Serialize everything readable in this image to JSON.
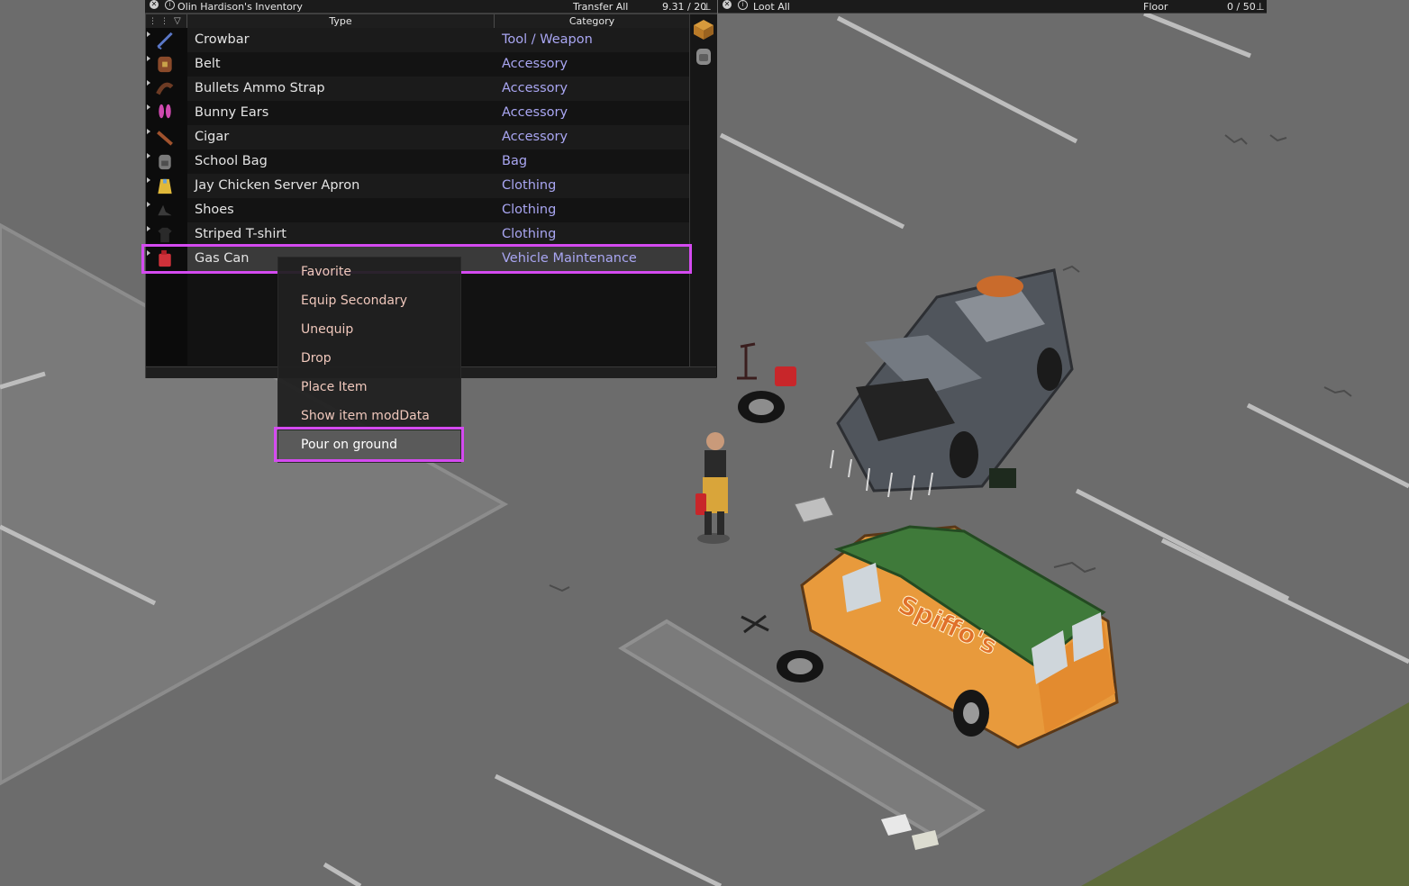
{
  "inventory": {
    "title": "Olin Hardison's Inventory",
    "transfer_all": "Transfer All",
    "weight": "9.31 / 20",
    "columns": {
      "type": "Type",
      "category": "Category"
    },
    "items": [
      {
        "type": "Crowbar",
        "category": "Tool / Weapon",
        "icon": "crowbar-icon"
      },
      {
        "type": "Belt",
        "category": "Accessory",
        "icon": "belt-icon"
      },
      {
        "type": "Bullets Ammo Strap",
        "category": "Accessory",
        "icon": "ammo-strap-icon"
      },
      {
        "type": "Bunny Ears",
        "category": "Accessory",
        "icon": "bunny-ears-icon"
      },
      {
        "type": "Cigar",
        "category": "Accessory",
        "icon": "cigar-icon"
      },
      {
        "type": "School Bag",
        "category": "Bag",
        "icon": "school-bag-icon"
      },
      {
        "type": "Jay Chicken Server Apron",
        "category": "Clothing",
        "icon": "apron-icon"
      },
      {
        "type": "Shoes",
        "category": "Clothing",
        "icon": "shoes-icon"
      },
      {
        "type": "Striped T-shirt",
        "category": "Clothing",
        "icon": "tshirt-icon"
      },
      {
        "type": "Gas Can",
        "category": "Vehicle Maintenance",
        "icon": "gas-can-icon"
      }
    ],
    "selected_index": 9
  },
  "loot": {
    "loot_all": "Loot All",
    "location": "Floor",
    "weight": "0 / 50"
  },
  "context_menu": {
    "items": [
      "Favorite",
      "Equip Secondary",
      "Unequip",
      "Drop",
      "Place Item",
      "Show item modData",
      "Pour on ground"
    ],
    "active_index": 6
  },
  "world": {
    "van_sign": "Spiffo's"
  },
  "colors": {
    "category_text": "#a9a6f2",
    "menu_text": "#f0c8bc",
    "highlight": "#d44af0"
  }
}
